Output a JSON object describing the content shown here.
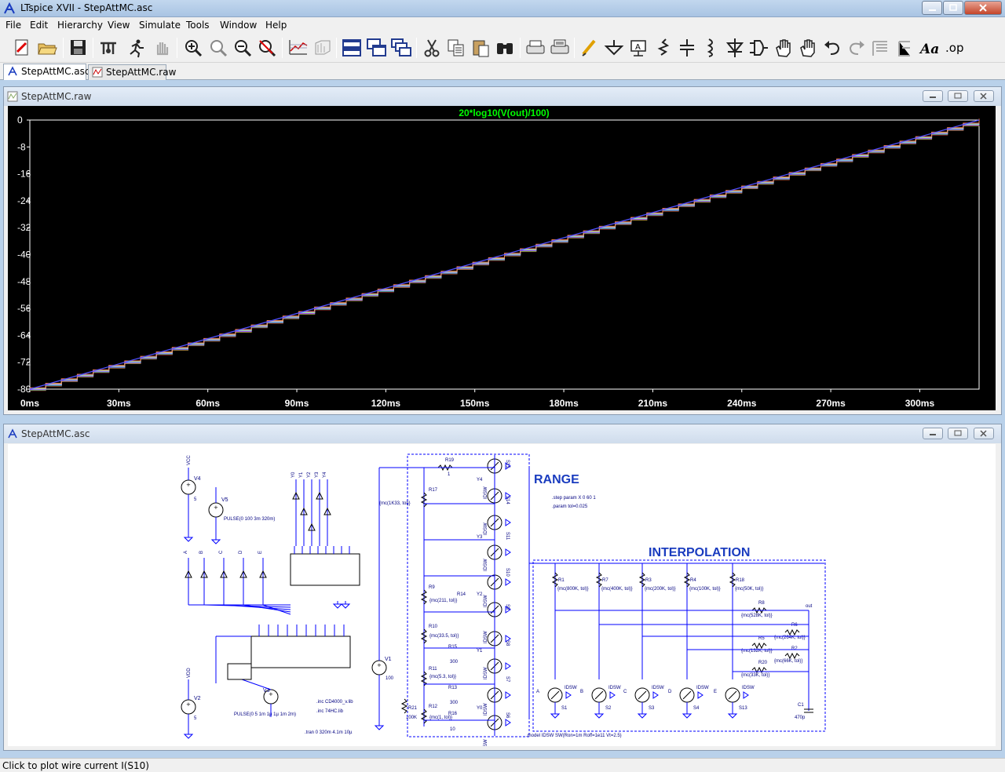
{
  "app": {
    "title": "LTspice XVII - StepAttMC.asc"
  },
  "menu": [
    "File",
    "Edit",
    "Hierarchy",
    "View",
    "Simulate",
    "Tools",
    "Window",
    "Help"
  ],
  "toolbar": {
    "icons": [
      "new-schematic-icon",
      "open-icon",
      "save-icon",
      "control-panel-icon",
      "run-icon",
      "halt-icon",
      "zoom-in-icon",
      "pan-icon",
      "zoom-out-icon",
      "zoom-fit-icon",
      "autorange-icon",
      "view-fft-icon",
      "tile-horizontal-icon",
      "tile-vertical-icon",
      "cascade-icon",
      "cut-icon",
      "copy-icon",
      "paste-icon",
      "find-icon",
      "print-icon",
      "print-preview-icon",
      "draw-wire-icon",
      "ground-icon",
      "label-net-icon",
      "resistor-icon",
      "capacitor-icon",
      "inductor-icon",
      "diode-icon",
      "component-icon",
      "move-icon",
      "drag-icon",
      "undo-icon",
      "redo-icon",
      "rotate-icon",
      "mirror-icon",
      "text-icon",
      "spice-directive-icon"
    ]
  },
  "tabs": [
    {
      "label": "StepAttMC.asc",
      "active": true,
      "icon": "schematic-icon"
    },
    {
      "label": "StepAttMC.raw",
      "active": false,
      "icon": "waveform-icon"
    }
  ],
  "waveform_window": {
    "title": "StepAttMC.raw"
  },
  "schematic_window": {
    "title": "StepAttMC.asc"
  },
  "status": "Click to plot wire current I(S10)",
  "colors": {
    "plot_bg": "#000000",
    "trace_label": "#00ff00",
    "grid_text": "#ffffff",
    "schematic_wire": "#0000ff",
    "schematic_text": "#000080"
  },
  "chart_data": {
    "type": "line",
    "title": "20*log10(V(out)/100)",
    "xlabel": "",
    "ylabel": "",
    "x_ticks": [
      "0ms",
      "30ms",
      "60ms",
      "90ms",
      "120ms",
      "150ms",
      "180ms",
      "210ms",
      "240ms",
      "270ms",
      "300ms"
    ],
    "y_ticks": [
      "0",
      "-8",
      "-16",
      "-24",
      "-32",
      "-40",
      "-48",
      "-56",
      "-64",
      "-72",
      "-80"
    ],
    "xlim": [
      0,
      320
    ],
    "ylim": [
      -80,
      0
    ],
    "series": [
      {
        "x": [
          0,
          320
        ],
        "values": [
          -80,
          0
        ],
        "color": "#5050ff"
      }
    ],
    "grid": false
  },
  "schematic": {
    "range_label": "RANGE",
    "interp_label": "INTERPOLATION",
    "directives": [
      ".step param X 0 60 1",
      ".param tol=0.025",
      ".model IDSW SW(Ron=1m Roff=1e11 Vt=2.5)",
      ".inc CD4000_v.lib",
      ".inc 74HC.lib",
      ".tran 0 320m 4.1m 10µ"
    ],
    "sources": [
      {
        "name": "V4",
        "value": "5",
        "net": "VCC"
      },
      {
        "name": "V5",
        "value": "PULSE(0 100 3m 320m)",
        "net": ""
      },
      {
        "name": "V2",
        "value": "5",
        "net": "VDD"
      },
      {
        "name": "V3",
        "value": "PULSE(0 5 1m 1µ 1µ 1m 2m)",
        "net": ""
      },
      {
        "name": "V1",
        "value": "100",
        "net": ""
      }
    ],
    "range_resistors": [
      {
        "name": "R19",
        "value": "1"
      },
      {
        "name": "R17",
        "value": "{mc(1K33, tol)}"
      },
      {
        "name": "R9",
        "value": "{mc(211, tol)}"
      },
      {
        "name": "R14",
        "value": "300"
      },
      {
        "name": "R10",
        "value": "{mc(33.5, tol)}"
      },
      {
        "name": "R15",
        "value": "300"
      },
      {
        "name": "R11",
        "value": "{mc(5.3, tol)}"
      },
      {
        "name": "R13",
        "value": "300"
      },
      {
        "name": "R12",
        "value": "{mc(1, tol)}"
      },
      {
        "name": "R16",
        "value": "10"
      },
      {
        "name": "R21",
        "value": "100K"
      }
    ],
    "interp_resistors": [
      {
        "name": "R1",
        "value": "{mc(800K, tol)}"
      },
      {
        "name": "R7",
        "value": "{mc(400K, tol)}"
      },
      {
        "name": "R3",
        "value": "{mc(200K, tol)}"
      },
      {
        "name": "R4",
        "value": "{mc(100K, tol)}"
      },
      {
        "name": "R18",
        "value": "{mc(50K, tol)}"
      },
      {
        "name": "R8",
        "value": "{mc(528K, tol)}"
      },
      {
        "name": "R6",
        "value": "{mc(264K, tol)}"
      },
      {
        "name": "R5",
        "value": "{mc(132K, tol)}"
      },
      {
        "name": "R2",
        "value": "{mc(66K, tol)}"
      },
      {
        "name": "R20",
        "value": "{mc(33K, tol)}"
      }
    ],
    "switches_range": [
      "S15",
      "S14",
      "S11",
      "S10",
      "S9",
      "S8",
      "S7",
      "S6"
    ],
    "switches_interp": [
      "S1",
      "S2",
      "S3",
      "S4",
      "S13"
    ],
    "switch_model": "IDSW",
    "cap": {
      "name": "C1",
      "value": "470p"
    },
    "out_label": "out",
    "y_nets": [
      "Y0",
      "Y1",
      "Y2",
      "Y3",
      "Y4"
    ],
    "digital_nets": [
      "A",
      "B",
      "C",
      "D",
      "E"
    ]
  }
}
